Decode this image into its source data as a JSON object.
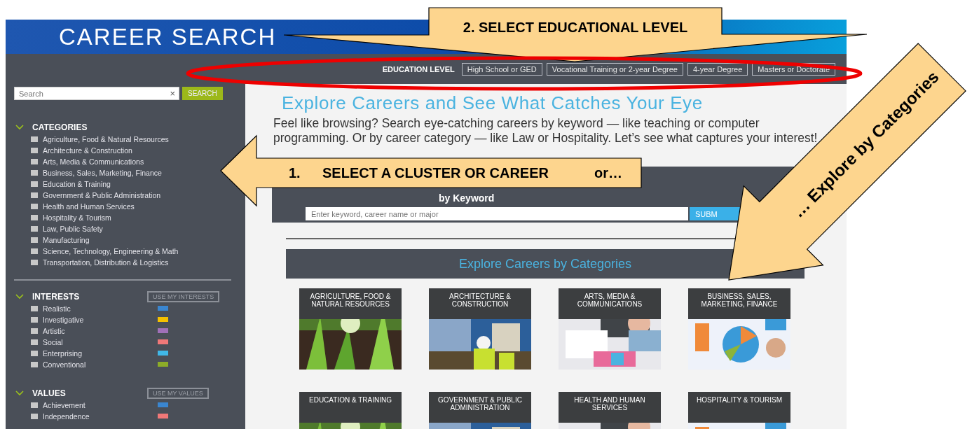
{
  "header": {
    "logo": "CAREER SEARCH"
  },
  "education": {
    "label": "EDUCATION LEVEL",
    "options": [
      "High School or GED",
      "Vocational Training or 2-year Degree",
      "4-year Degree",
      "Masters or Doctorate"
    ]
  },
  "sidebar": {
    "search": {
      "placeholder": "Search",
      "clear": "×",
      "button": "SEARCH"
    },
    "sections": [
      {
        "title": "CATEGORIES",
        "expanded": true,
        "items": [
          {
            "label": "Agriculture, Food & Natural Resources",
            "checked": false
          },
          {
            "label": "Architecture & Construction",
            "checked": false
          },
          {
            "label": "Arts, Media & Communications",
            "checked": false
          },
          {
            "label": "Business, Sales, Marketing, Finance",
            "checked": false
          },
          {
            "label": "Education & Training",
            "checked": false
          },
          {
            "label": "Government & Public Administration",
            "checked": false
          },
          {
            "label": "Health and Human Services",
            "checked": false
          },
          {
            "label": "Hospitality & Tourism",
            "checked": false
          },
          {
            "label": "Law, Public Safety",
            "checked": false
          },
          {
            "label": "Manufacturing",
            "checked": false
          },
          {
            "label": "Science, Technology, Engineering & Math",
            "checked": false
          },
          {
            "label": "Transportation, Distribution & Logistics",
            "checked": false
          }
        ]
      },
      {
        "title": "INTERESTS",
        "expanded": true,
        "action": "USE MY INTERESTS",
        "items": [
          {
            "label": "Realistic",
            "checked": false,
            "color": "#3a86d0"
          },
          {
            "label": "Investigative",
            "checked": false,
            "color": "#f5c000"
          },
          {
            "label": "Artistic",
            "checked": false,
            "color": "#a070b8"
          },
          {
            "label": "Social",
            "checked": false,
            "color": "#f07878"
          },
          {
            "label": "Enterprising",
            "checked": false,
            "color": "#40b8e8"
          },
          {
            "label": "Conventional",
            "checked": false,
            "color": "#8cac28"
          }
        ]
      },
      {
        "title": "VALUES",
        "expanded": true,
        "action": "USE MY VALUES",
        "items": [
          {
            "label": "Achievement",
            "checked": false,
            "color": "#3a86d0"
          },
          {
            "label": "Independence",
            "checked": false,
            "color": "#f07878"
          }
        ]
      }
    ]
  },
  "main": {
    "title": "Explore Careers and See What Catches Your Eye",
    "intro": "Feel like browsing? Search eye-catching careers by keyword — like teaching or computer programming. Or by career category — like Law or Hospitality. Let’s see what captures your interest!",
    "keyword_search": {
      "subtitle": "by Keyword",
      "placeholder": "Enter keyword, career name or major",
      "button": "SUBM"
    },
    "categories_heading": "Explore Careers by Categories",
    "cards": [
      {
        "title": "AGRICULTURE, FOOD & NATURAL RESOURCES"
      },
      {
        "title": "ARCHITECTURE & CONSTRUCTION"
      },
      {
        "title": "ARTS, MEDIA & COMMUNICATIONS"
      },
      {
        "title": "BUSINESS, SALES, MARKETING, FINANCE"
      },
      {
        "title": "EDUCATION & TRAINING"
      },
      {
        "title": "GOVERNMENT & PUBLIC ADMINISTRATION"
      },
      {
        "title": "HEALTH AND HUMAN SERVICES"
      },
      {
        "title": "HOSPITALITY & TOURISM"
      }
    ]
  },
  "annotations": [
    {
      "kind": "banner",
      "text": "2. SELECT EDUCATIONAL LEVEL"
    },
    {
      "kind": "ellipse"
    },
    {
      "kind": "left-arrow",
      "number": "1.",
      "text": "SELECT A CLUSTER OR CAREER",
      "suffix": "or…"
    },
    {
      "kind": "diagonal-arrow",
      "text": "… Explore by Categories"
    }
  ]
}
